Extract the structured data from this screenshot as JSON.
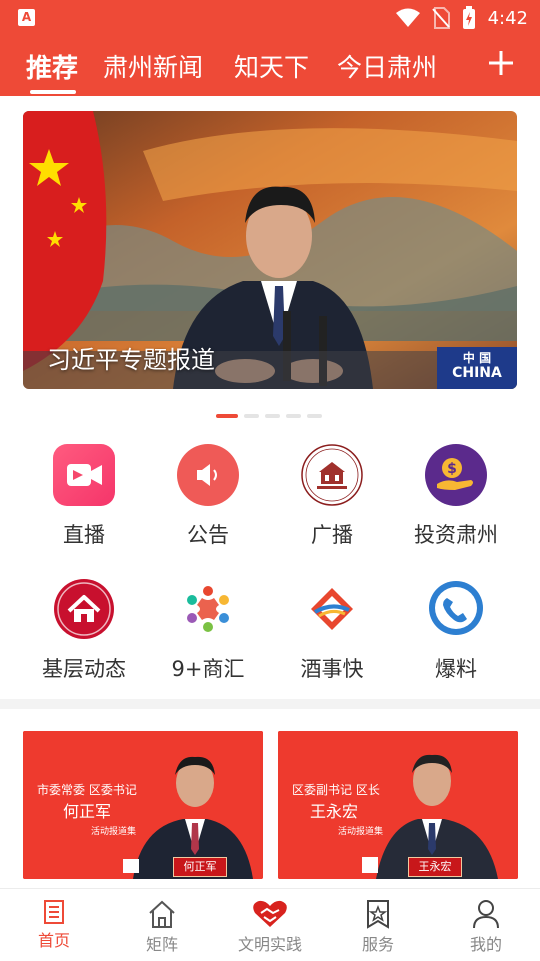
{
  "status_bar": {
    "app_badge": "A",
    "time": "4:42"
  },
  "top_nav": {
    "tabs": [
      {
        "label": "推荐",
        "active": true
      },
      {
        "label": "肃州新闻",
        "active": false
      },
      {
        "label": "知天下",
        "active": false
      },
      {
        "label": "今日肃州",
        "active": false
      }
    ],
    "add_icon": "plus-icon"
  },
  "banner": {
    "caption": "习近平专题报道",
    "podium_text_cn": "中 国",
    "podium_text_en": "CHINA",
    "total_slides": 5,
    "active_slide": 1
  },
  "services": [
    {
      "label": "直播",
      "icon": "video-camera-icon",
      "color": "#f5486b"
    },
    {
      "label": "公告",
      "icon": "speaker-icon",
      "color": "#ef5a57"
    },
    {
      "label": "广播",
      "icon": "radio-emblem-icon",
      "color": "#8b1d1d"
    },
    {
      "label": "投资肃州",
      "icon": "money-hand-icon",
      "color": "#5b2a8c"
    },
    {
      "label": "基层动态",
      "icon": "house-icon",
      "color": "#c8102e"
    },
    {
      "label": "9+商汇",
      "icon": "people-circle-icon",
      "color": "#3a8fd8"
    },
    {
      "label": "酒事快",
      "icon": "diamond-road-icon",
      "color": "#e8472f"
    },
    {
      "label": "爆料",
      "icon": "phone-globe-icon",
      "color": "#2d7fd1"
    }
  ],
  "cards": [
    {
      "title": "市委常委 区委书记",
      "name": "何正军",
      "subtitle": "活动报道集",
      "nameplate": "何正军"
    },
    {
      "title": "区委副书记 区长",
      "name": "王永宏",
      "subtitle": "活动报道集",
      "nameplate": "王永宏"
    }
  ],
  "bottom_nav": [
    {
      "label": "首页",
      "icon": "newspaper-icon",
      "active": true
    },
    {
      "label": "矩阵",
      "icon": "house-outline-icon",
      "active": false
    },
    {
      "label": "文明实践",
      "icon": "handshake-heart-icon",
      "active": false
    },
    {
      "label": "服务",
      "icon": "bookmark-star-icon",
      "active": false
    },
    {
      "label": "我的",
      "icon": "person-icon",
      "active": false
    }
  ],
  "colors": {
    "brand": "#ee4a37",
    "text": "#333333",
    "muted": "#888888"
  }
}
